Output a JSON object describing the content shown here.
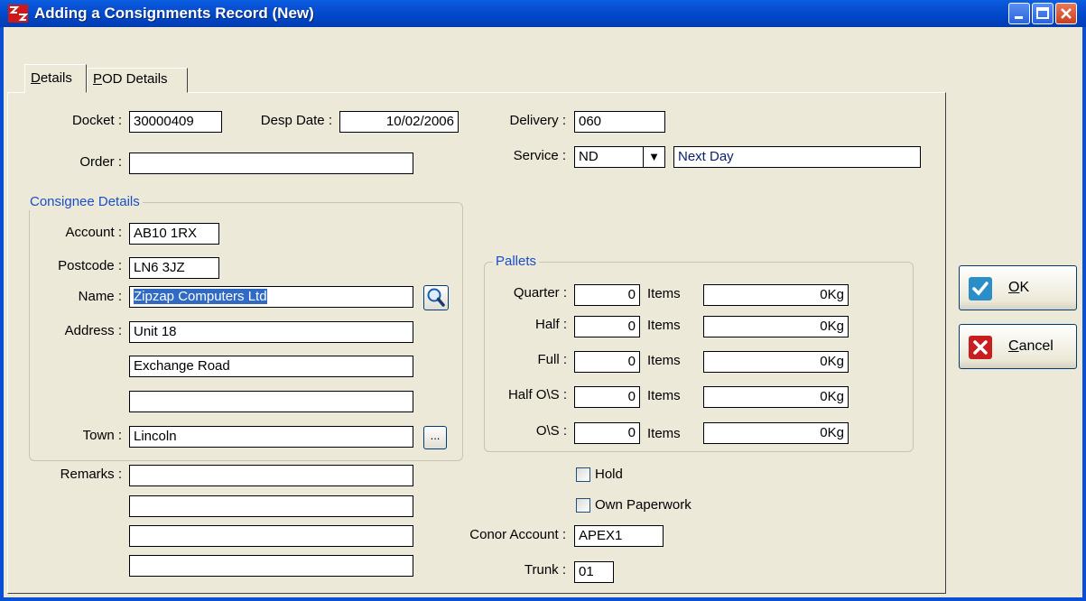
{
  "window": {
    "title": "Adding a Consignments Record  (New)"
  },
  "tabs": [
    {
      "label": "Details",
      "accel": "D",
      "rest": "etails",
      "active": true
    },
    {
      "label": "POD Details",
      "accel": "P",
      "rest": "OD Details",
      "active": false
    }
  ],
  "header": {
    "docket_label": "Docket :",
    "docket_value": "30000409",
    "desp_date_label": "Desp Date :",
    "desp_date_value": "10/02/2006",
    "order_label": "Order :",
    "order_value": "",
    "delivery_label": "Delivery :",
    "delivery_value": "060",
    "service_label": "Service :",
    "service_code": "ND",
    "service_name": "Next Day"
  },
  "consignee": {
    "group_title": "Consignee Details",
    "account_label": "Account :",
    "account_value": "AB10 1RX",
    "postcode_label": "Postcode :",
    "postcode_value": "LN6 3JZ",
    "name_label": "Name :",
    "name_value": "Zipzap Computers Ltd",
    "address_label": "Address :",
    "address_lines": [
      "Unit 18",
      "Exchange Road",
      ""
    ],
    "town_label": "Town :",
    "town_value": "Lincoln",
    "town_lookup_label": "..."
  },
  "remarks": {
    "label": "Remarks :",
    "lines": [
      "",
      "",
      "",
      ""
    ]
  },
  "pallets": {
    "group_title": "Pallets",
    "items_label": "Items",
    "rows": [
      {
        "label": "Quarter :",
        "count": "0",
        "weight": "0Kg"
      },
      {
        "label": "Half :",
        "count": "0",
        "weight": "0Kg"
      },
      {
        "label": "Full :",
        "count": "0",
        "weight": "0Kg"
      },
      {
        "label": "Half O\\S :",
        "count": "0",
        "weight": "0Kg"
      },
      {
        "label": "O\\S :",
        "count": "0",
        "weight": "0Kg"
      }
    ]
  },
  "options": {
    "hold_label": "Hold",
    "hold_checked": false,
    "own_paperwork_label": "Own Paperwork",
    "own_paperwork_checked": false,
    "conor_account_label": "Conor Account :",
    "conor_account_value": "APEX1",
    "trunk_label": "Trunk :",
    "trunk_value": "01"
  },
  "buttons": {
    "ok_label": "OK",
    "ok_accel": "O",
    "ok_rest": "K",
    "cancel_label": "Cancel",
    "cancel_accel": "C",
    "cancel_rest": "ancel"
  },
  "colors": {
    "titlebar": "#0a54d8",
    "group_title": "#1a4ec8",
    "selection": "#316ac5",
    "ok_check": "#2a8ec8",
    "cancel_x": "#c81e1e"
  }
}
